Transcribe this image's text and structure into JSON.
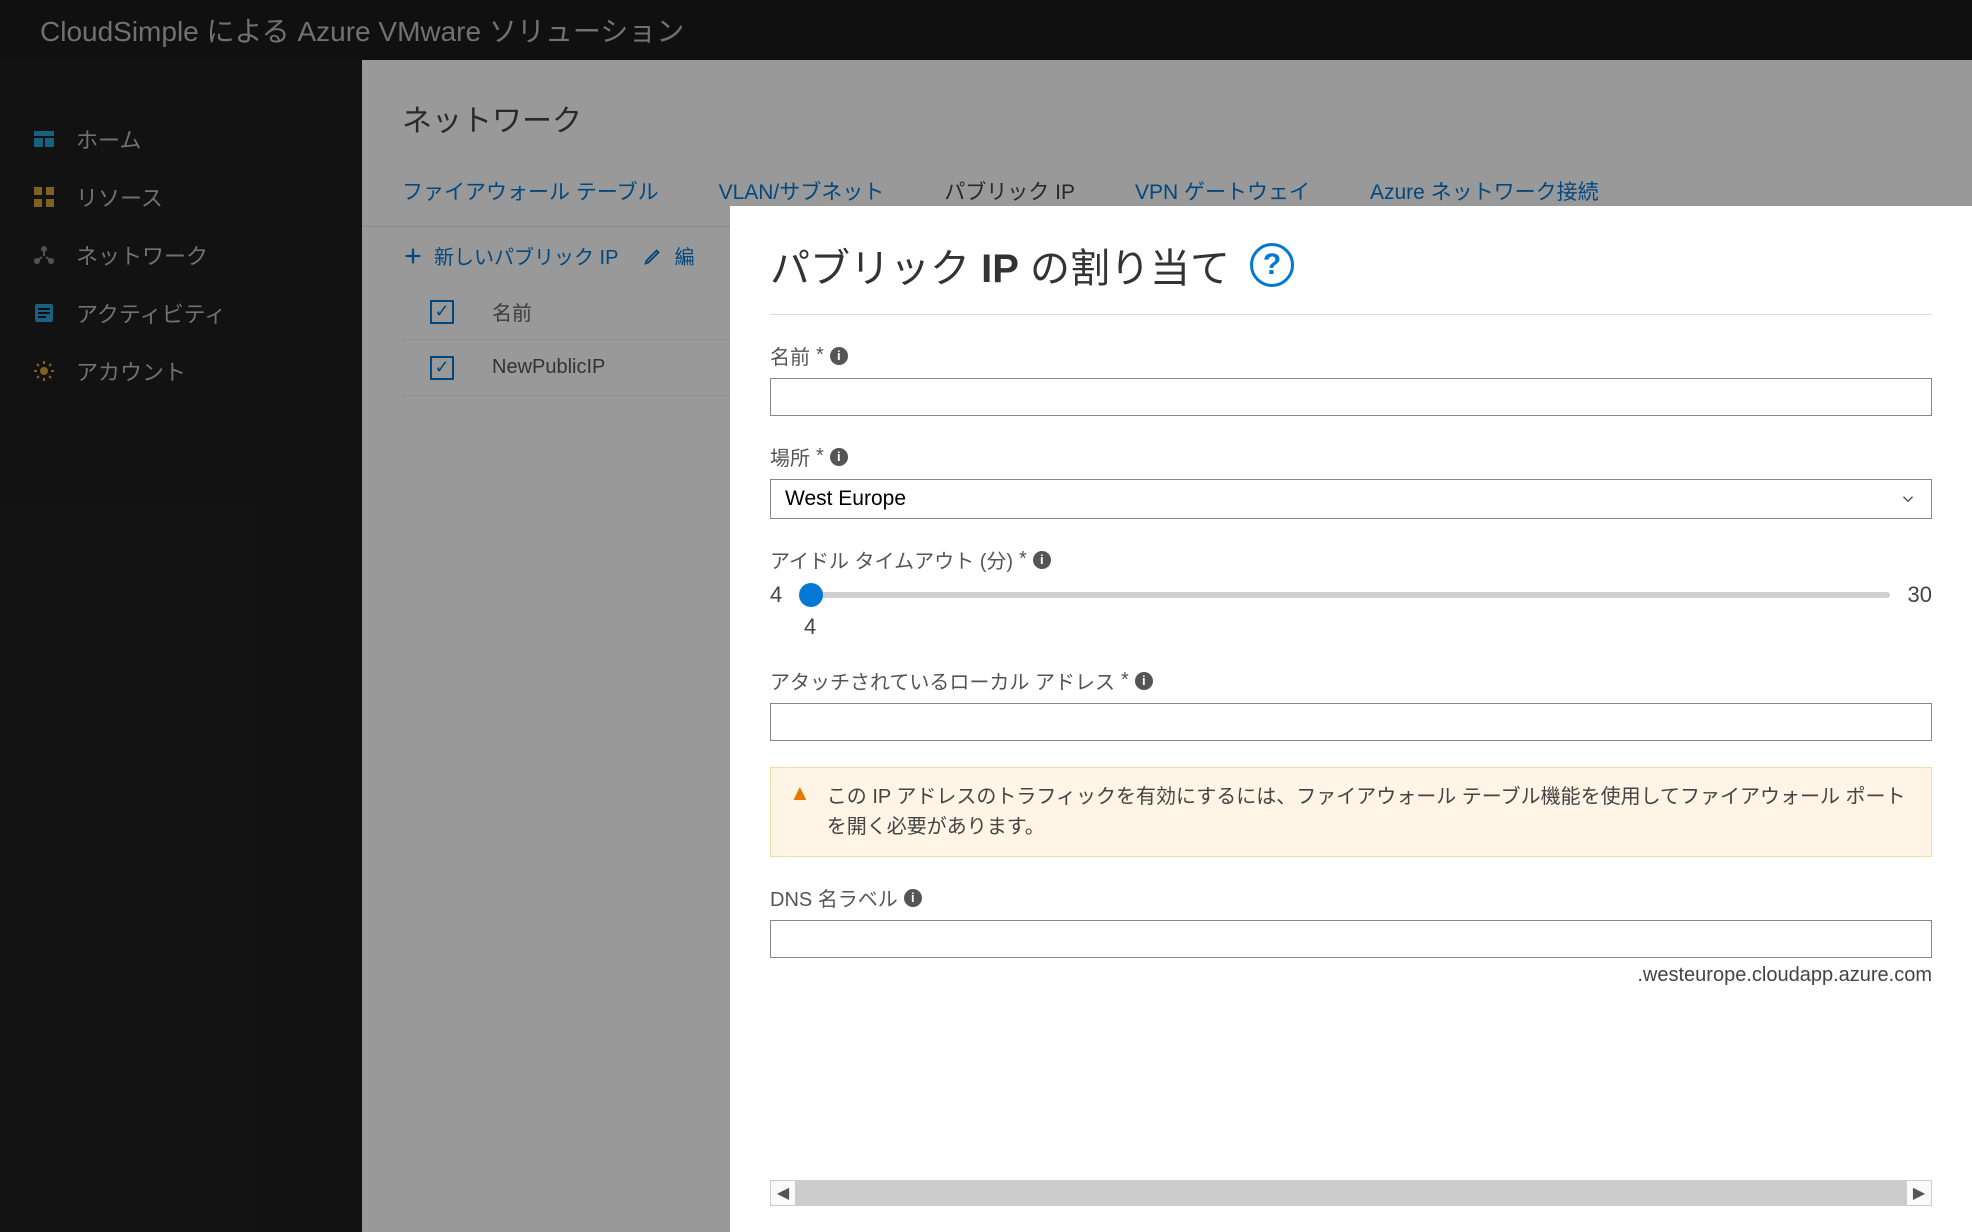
{
  "topbar": {
    "title": "CloudSimple による Azure VMware ソリューション"
  },
  "sidebar": {
    "items": [
      {
        "label": "ホーム",
        "icon": "home-icon"
      },
      {
        "label": "リソース",
        "icon": "resources-icon"
      },
      {
        "label": "ネットワーク",
        "icon": "network-icon"
      },
      {
        "label": "アクティビティ",
        "icon": "activity-icon"
      },
      {
        "label": "アカウント",
        "icon": "account-icon"
      }
    ]
  },
  "page": {
    "title": "ネットワーク",
    "tabs": [
      {
        "label": "ファイアウォール テーブル",
        "active": false
      },
      {
        "label": "VLAN/サブネット",
        "active": false
      },
      {
        "label": "パブリック IP",
        "active": true
      },
      {
        "label": "VPN ゲートウェイ",
        "active": false
      },
      {
        "label": "Azure ネットワーク接続",
        "active": false
      }
    ],
    "toolbar": {
      "new_label": "新しいパブリック IP",
      "edit_label": "編"
    },
    "table": {
      "headers": {
        "name": "名前"
      },
      "rows": [
        {
          "name": "NewPublicIP",
          "checked": true
        }
      ]
    }
  },
  "panel": {
    "title_prefix": "パブリック ",
    "title_bold": "IP",
    "title_suffix": " の割り当て",
    "help": "?",
    "fields": {
      "name": {
        "label": "名前",
        "required": "*",
        "value": ""
      },
      "location": {
        "label": "場所",
        "required": "*",
        "value": "West Europe"
      },
      "timeout": {
        "label": "アイドル タイムアウト (分)",
        "required": "*",
        "min": "4",
        "max": "30",
        "value": "4"
      },
      "local": {
        "label": "アタッチされているローカル アドレス",
        "required": "*",
        "value": ""
      },
      "dns": {
        "label": "DNS 名ラベル",
        "value": "",
        "suffix": ".westeurope.cloudapp.azure.com"
      }
    },
    "alert": {
      "text": "この IP アドレスのトラフィックを有効にするには、ファイアウォール テーブル機能を使用してファイアウォール ポートを開く必要があります。"
    }
  }
}
